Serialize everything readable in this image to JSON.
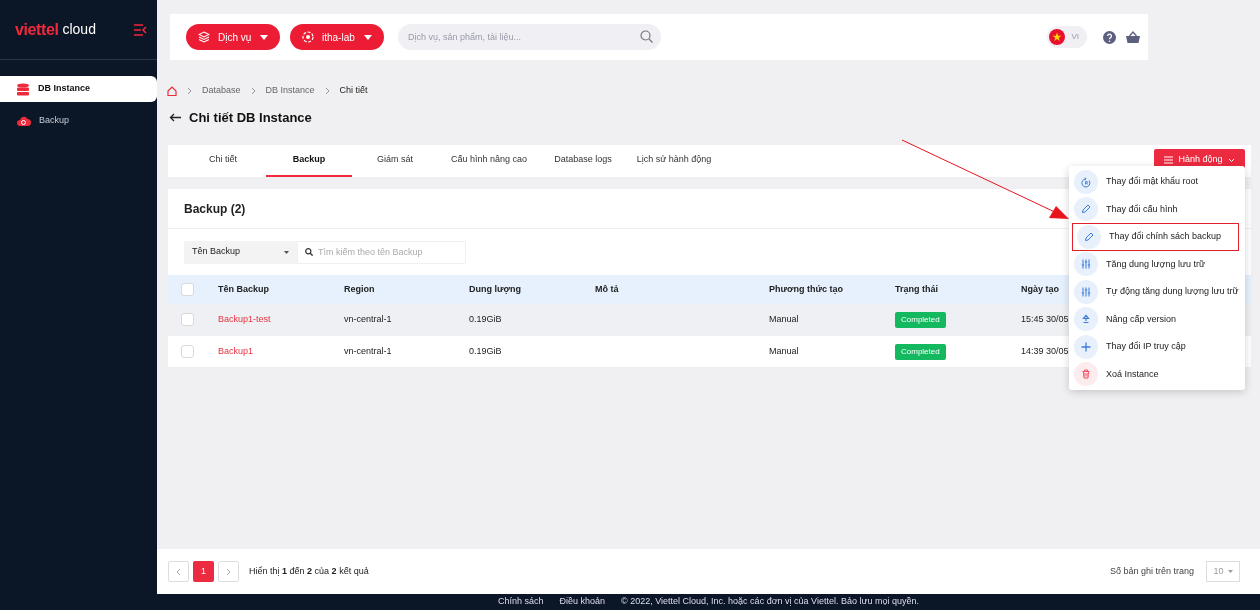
{
  "brand": {
    "name": "viettel",
    "suffix": "cloud"
  },
  "sidebar": {
    "items": [
      {
        "label": "DB Instance",
        "kind": "database",
        "selected": true
      },
      {
        "label": "Backup",
        "kind": "cloud",
        "selected": false
      }
    ]
  },
  "header": {
    "service_button": "Dịch vụ",
    "project_button": "itha-lab",
    "search": {
      "placeholder": "Dịch vụ, sản phẩm, tài liệu..."
    },
    "language": "VI"
  },
  "breadcrumb": [
    "Database",
    "DB Instance",
    "Chi tiết"
  ],
  "page_title": "Chi tiết DB Instance",
  "tabs": [
    {
      "label": "Chi tiết",
      "selected": false
    },
    {
      "label": "Backup",
      "selected": true
    },
    {
      "label": "Giám sát",
      "selected": false
    },
    {
      "label": "Cấu hình nâng cao",
      "selected": false
    },
    {
      "label": "Database logs",
      "selected": false
    },
    {
      "label": "Lịch sử hành động",
      "selected": false
    }
  ],
  "action_button": "Hành động",
  "action_menu": [
    {
      "label": "Thay đổi mật khẩu root",
      "kind": "reset",
      "highlighted": false
    },
    {
      "label": "Thay đổi cấu hình",
      "kind": "edit",
      "highlighted": false
    },
    {
      "label": "Thay đổi chính sách backup",
      "kind": "edit",
      "highlighted": true
    },
    {
      "label": "Tăng dung lượng lưu trữ",
      "kind": "sliders",
      "highlighted": false
    },
    {
      "label": "Tự động tăng dung lượng lưu trữ",
      "kind": "sliders",
      "highlighted": false
    },
    {
      "label": "Nâng cấp version",
      "kind": "upload",
      "highlighted": false
    },
    {
      "label": "Thay đổi IP truy cập",
      "kind": "plus",
      "highlighted": false
    },
    {
      "label": "Xoá Instance",
      "kind": "delete",
      "highlighted": false
    }
  ],
  "backup_card": {
    "title": "Backup (2)",
    "filter_select": "Tên Backup",
    "search": {
      "placeholder": "Tìm kiếm theo tên Backup"
    }
  },
  "table": {
    "select_all_checked": false,
    "columns": [
      "Tên Backup",
      "Region",
      "Dung lượng",
      "Mô tả",
      "Phương thức tạo",
      "Trạng thái",
      "Ngày tạo"
    ],
    "rows": [
      {
        "checked": false,
        "hovered": true,
        "cells": [
          "Backup1-test",
          "vn-central-1",
          "0.19GiB",
          "",
          "Manual",
          "Completed",
          "15:45 30/05"
        ]
      },
      {
        "checked": false,
        "hovered": false,
        "cells": [
          "Backup1",
          "vn-central-1",
          "0.19GiB",
          "",
          "Manual",
          "Completed",
          "14:39 30/05"
        ]
      }
    ]
  },
  "pagination": {
    "pages": [
      {
        "label": "1",
        "selected": true
      }
    ],
    "summary": "Hiển thị **1** đến **2** của **2** kết quả",
    "page_size_label": "Số bản ghi trên trang",
    "page_size": "10"
  },
  "footer": {
    "links": [
      "Chính sách",
      "Điều khoản"
    ],
    "copyright": "© 2022, Viettel Cloud, Inc. hoặc các đơn vị của Viettel. Bảo lưu mọi quyền."
  }
}
